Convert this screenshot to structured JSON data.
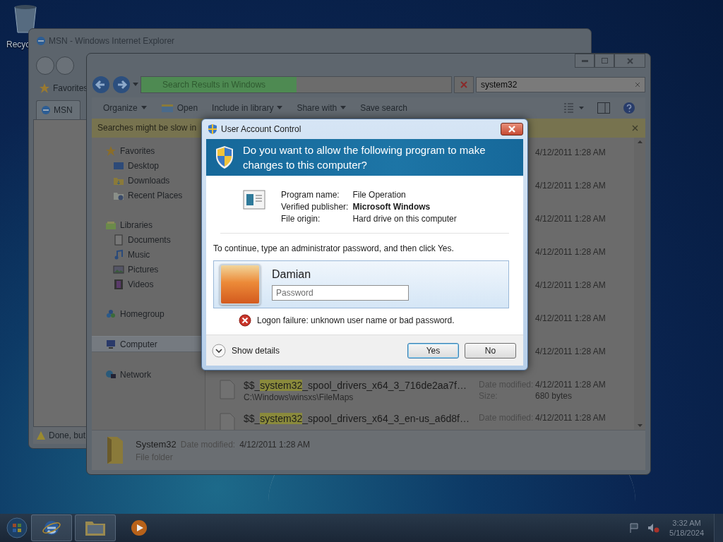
{
  "desktop": {
    "icons": [
      {
        "label": "Recyc"
      }
    ]
  },
  "ie_window": {
    "title": "MSN - Windows Internet Explorer",
    "favorites": "Favorites",
    "tab": "MSN",
    "status": "Done, but"
  },
  "explorer": {
    "address": {
      "crumb": "Search Results in Windows",
      "level": 0.5
    },
    "search": {
      "value": "system32"
    },
    "toolbar": [
      {
        "label": "Organize",
        "kind": "menu"
      },
      {
        "label": "Open",
        "kind": "icon"
      },
      {
        "label": "Include in library",
        "kind": "menu"
      },
      {
        "label": "Share with",
        "kind": "menu"
      },
      {
        "label": "Save search",
        "kind": "plain"
      }
    ],
    "infobar": "Searches might be slow in",
    "nav": [
      {
        "label": "Favorites",
        "selected": false,
        "children": [
          {
            "label": "Desktop",
            "selected": false
          },
          {
            "label": "Downloads",
            "selected": false
          },
          {
            "label": "Recent Places",
            "selected": false
          }
        ]
      },
      {
        "label": "Libraries",
        "selected": false,
        "children": [
          {
            "label": "Documents",
            "selected": false
          },
          {
            "label": "Music",
            "selected": false
          },
          {
            "label": "Pictures",
            "selected": false
          },
          {
            "label": "Videos",
            "selected": false
          }
        ]
      },
      {
        "label": "Homegroup",
        "selected": false
      },
      {
        "label": "Computer",
        "selected": true
      },
      {
        "label": "Network",
        "selected": false
      }
    ],
    "results": [
      {
        "date": "4/12/2011 1:28 AM"
      },
      {
        "date": "4/12/2011 1:28 AM"
      },
      {
        "date": "4/12/2011 1:28 AM"
      },
      {
        "date": "4/12/2011 1:28 AM"
      },
      {
        "date": "4/12/2011 1:28 AM"
      },
      {
        "date": "4/12/2011 1:28 AM"
      },
      {
        "date": "4/12/2011 1:28 AM"
      },
      {
        "name": [
          {
            "text": "$$_",
            "match": false
          },
          {
            "text": "system32",
            "match": true
          },
          {
            "text": "_spool_drivers_x64_3_716de2aa7f…",
            "match": false
          }
        ],
        "path": "C:\\Windows\\winsxs\\FileMaps",
        "date_label": "Date modified:",
        "date": "4/12/2011 1:28 AM",
        "size_label": "Size:",
        "size": "680 bytes"
      },
      {
        "name": [
          {
            "text": "$$_",
            "match": false
          },
          {
            "text": "system32",
            "match": true
          },
          {
            "text": "_spool_drivers_x64_3_en-us_a6d8f…",
            "match": false
          }
        ],
        "date_label": "Date modified:",
        "date": "4/12/2011 1:28 AM"
      }
    ],
    "details": {
      "name": "System32",
      "date_label": "Date modified:",
      "date": "4/12/2011 1:28 AM",
      "type": "File folder"
    }
  },
  "uac": {
    "title": "User Account Control",
    "question": "Do you want to allow the following program to make changes to this computer?",
    "fields": [
      {
        "label": "Program name:",
        "value": "File Operation",
        "bold": false
      },
      {
        "label": "Verified publisher:",
        "value": "Microsoft Windows",
        "bold": true
      },
      {
        "label": "File origin:",
        "value": "Hard drive on this computer",
        "bold": false
      }
    ],
    "prompt": "To continue, type an administrator password, and then click Yes.",
    "user": {
      "name": "Damian",
      "placeholder": "Password"
    },
    "error": "Logon failure: unknown user name or bad password.",
    "details_toggle": {
      "label": "Show details",
      "expanded": false
    },
    "buttons": [
      {
        "label": "Yes",
        "default": true
      },
      {
        "label": "No",
        "default": false
      }
    ]
  },
  "taskbar": {
    "apps": [
      {
        "kind": "browser",
        "running": true
      },
      {
        "kind": "folder",
        "running": true
      },
      {
        "kind": "media",
        "running": false
      }
    ],
    "clock": {
      "time": "3:32 AM",
      "date": "5/18/2024"
    }
  }
}
